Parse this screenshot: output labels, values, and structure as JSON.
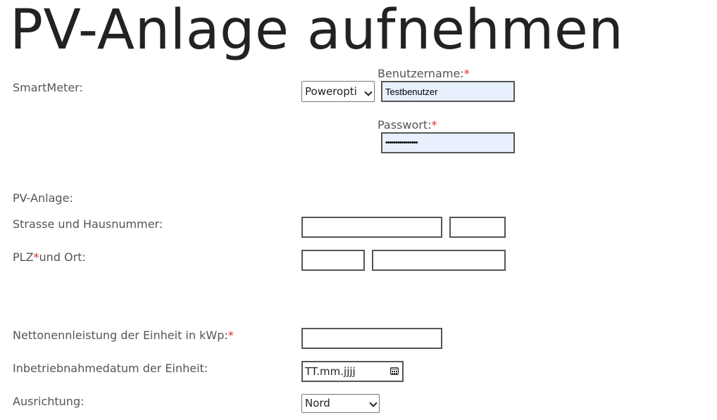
{
  "page": {
    "title": "PV-Anlage aufnehmen"
  },
  "smartmeter": {
    "label": "SmartMeter:",
    "selected": "Poweropti",
    "username_label": "Benutzername:",
    "username_value": "Testbenutzer",
    "password_label": "Passwort:",
    "password_value": "••••••••••••••••"
  },
  "pv": {
    "section_label": "PV-Anlage:",
    "street_label": "Strasse und Hausnummer:",
    "street_value": "",
    "house_number_value": "",
    "plz_label": "PLZ",
    "ort_label": "und Ort:",
    "plz_value": "",
    "ort_value": "",
    "power_label": "Nettonennleistung der Einheit in kWp:",
    "power_value": "",
    "date_label": "Inbetriebnahmedatum der Einheit:",
    "date_placeholder": "TT.mm.jjjj",
    "orientation_label": "Ausrichtung:",
    "orientation_selected": "Nord"
  },
  "required_marker": "*",
  "icons": {
    "select_arrow": "chevron-down-icon",
    "date_picker": "calendar-icon"
  },
  "colors": {
    "required": "#e02b2b",
    "autofill_background": "#e8f0fe",
    "title": "#222222",
    "label": "#555555"
  }
}
